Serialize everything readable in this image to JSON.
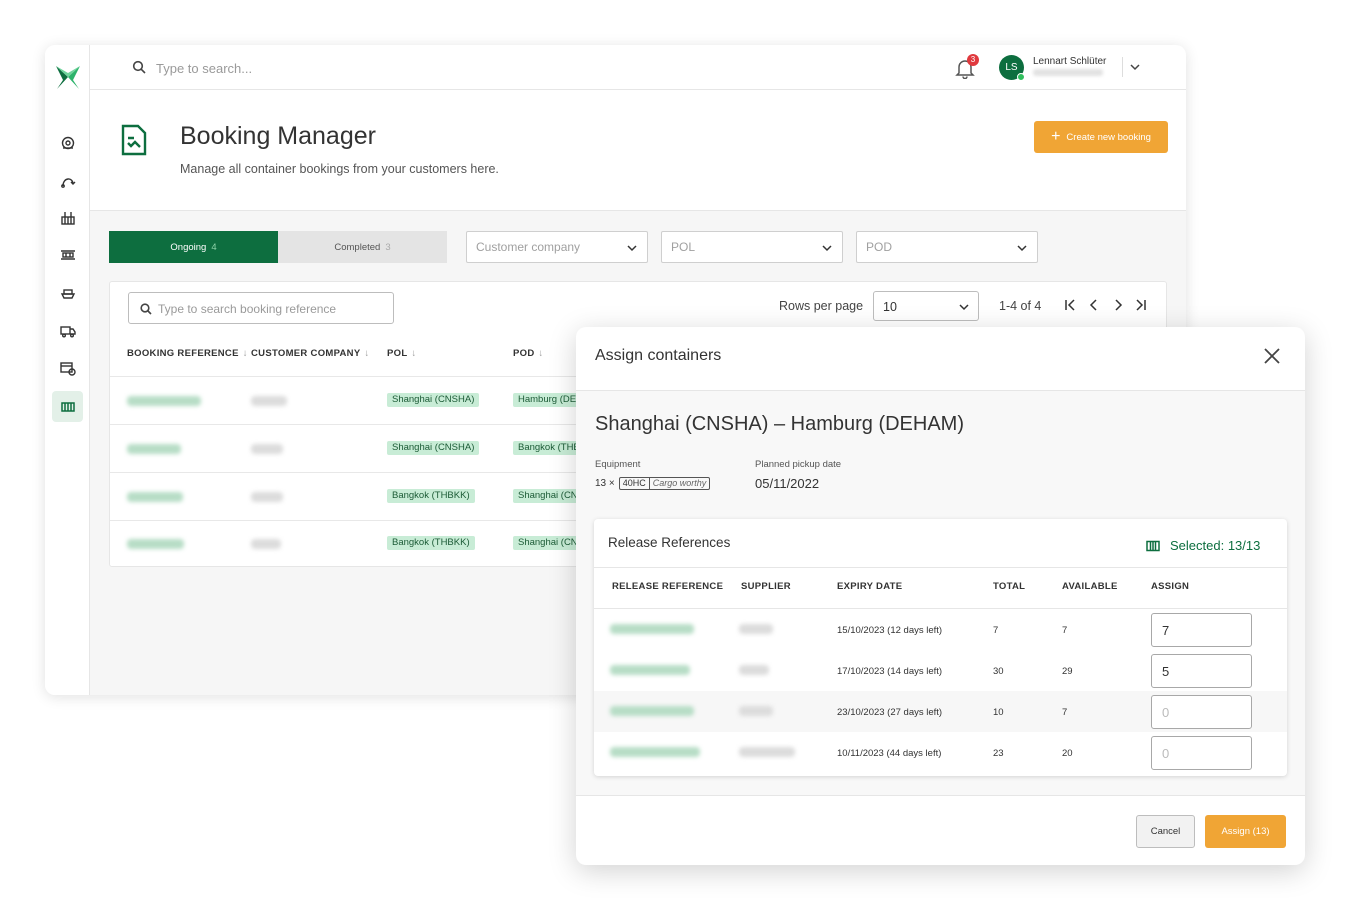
{
  "topbar": {
    "search_placeholder": "Type to search...",
    "notification_count": "3",
    "user_initials": "LS",
    "user_name": "Lennart Schlüter"
  },
  "header": {
    "title": "Booking Manager",
    "subtitle": "Manage all container bookings from your customers here.",
    "create_button": "Create new booking"
  },
  "filters": {
    "tabs": [
      {
        "label": "Ongoing",
        "count": "4"
      },
      {
        "label": "Completed",
        "count": "3"
      }
    ],
    "customer_company_placeholder": "Customer company",
    "pol_placeholder": "POL",
    "pod_placeholder": "POD"
  },
  "table": {
    "search_placeholder": "Type to search booking reference",
    "rows_per_page_label": "Rows per page",
    "rows_per_page_value": "10",
    "range_text": "1-4 of 4",
    "columns": [
      "BOOKING REFERENCE",
      "CUSTOMER COMPANY",
      "POL",
      "POD"
    ],
    "rows": [
      {
        "pol": "Shanghai (CNSHA)",
        "pod": "Hamburg (DEH"
      },
      {
        "pol": "Shanghai (CNSHA)",
        "pod": "Bangkok (THE"
      },
      {
        "pol": "Bangkok (THBKK)",
        "pod": "Shanghai (CN"
      },
      {
        "pol": "Bangkok (THBKK)",
        "pod": "Shanghai (CN"
      }
    ]
  },
  "modal": {
    "title": "Assign containers",
    "route": "Shanghai (CNSHA) – Hamburg (DEHAM)",
    "equipment_label": "Equipment",
    "equipment_qty": "13 ×",
    "equipment_type": "40HC",
    "equipment_condition": "Cargo worthy",
    "pickup_label": "Planned pickup date",
    "pickup_date": "05/11/2022",
    "release_refs": {
      "title": "Release References",
      "selected": "Selected: 13/13",
      "columns": [
        "RELEASE REFERENCE",
        "SUPPLIER",
        "EXPIRY DATE",
        "TOTAL",
        "AVAILABLE",
        "ASSIGN"
      ],
      "rows": [
        {
          "expiry": "15/10/2023  (12 days left)",
          "total": "7",
          "available": "7",
          "assign": "7",
          "placeholder": ""
        },
        {
          "expiry": "17/10/2023  (14 days left)",
          "total": "30",
          "available": "29",
          "assign": "5",
          "placeholder": ""
        },
        {
          "expiry": "23/10/2023  (27 days left)",
          "total": "10",
          "available": "7",
          "assign": "",
          "placeholder": "0"
        },
        {
          "expiry": "10/11/2023  (44 days left)",
          "total": "23",
          "available": "20",
          "assign": "",
          "placeholder": "0"
        }
      ]
    },
    "cancel_label": "Cancel",
    "assign_label": "Assign (13)"
  },
  "colors": {
    "brand_green": "#0d6e3f",
    "accent_orange": "#f0a535",
    "tag_green": "#c8ecd6"
  }
}
